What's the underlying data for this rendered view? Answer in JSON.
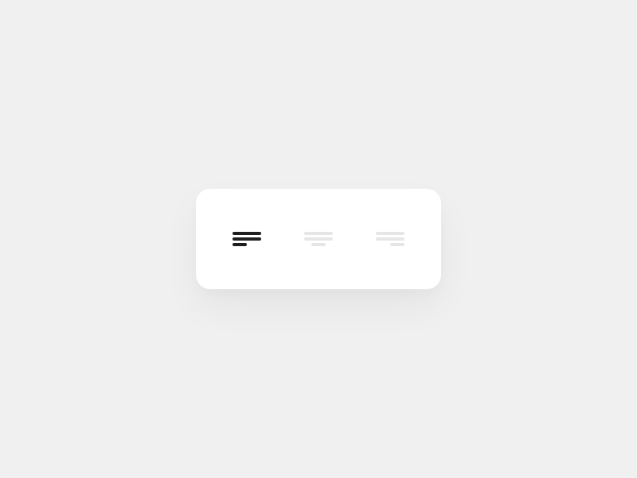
{
  "alignment_toggle": {
    "options": [
      {
        "id": "left",
        "icon": "align-left-icon",
        "selected": true
      },
      {
        "id": "center",
        "icon": "align-center-icon",
        "selected": false
      },
      {
        "id": "right",
        "icon": "align-right-icon",
        "selected": false
      }
    ]
  },
  "colors": {
    "background": "#f0f0f0",
    "card": "#ffffff",
    "active_icon": "#1e1e1e",
    "inactive_icon": "#e6e6e6"
  }
}
